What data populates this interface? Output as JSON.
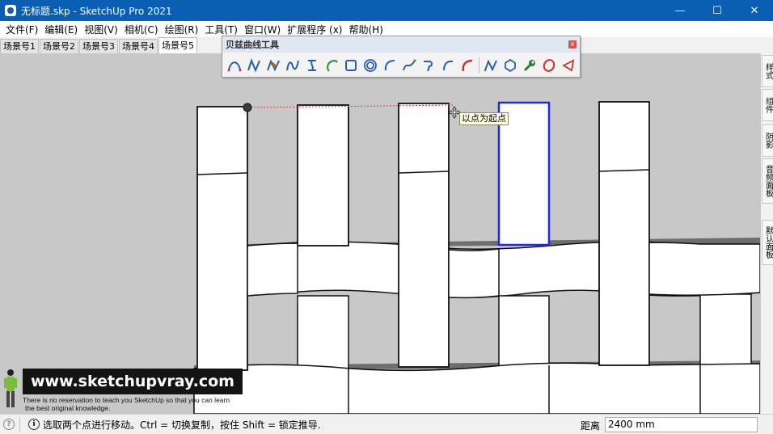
{
  "window": {
    "title": "无标题.skp - SketchUp Pro 2021",
    "minimize_glyph": "—",
    "maximize_glyph": "☐",
    "close_glyph": "✕",
    "titlebar_color": "#0b5fb3"
  },
  "menu": {
    "items": [
      {
        "label": "文件(F)"
      },
      {
        "label": "编辑(E)"
      },
      {
        "label": "视图(V)"
      },
      {
        "label": "相机(C)"
      },
      {
        "label": "绘图(R)"
      },
      {
        "label": "工具(T)"
      },
      {
        "label": "窗口(W)"
      },
      {
        "label": "扩展程序 (x)"
      },
      {
        "label": "帮助(H)"
      }
    ]
  },
  "scene_tabs": [
    {
      "label": "场景号1",
      "active": false
    },
    {
      "label": "场景号2",
      "active": false
    },
    {
      "label": "场景号3",
      "active": false
    },
    {
      "label": "场景号4",
      "active": false
    },
    {
      "label": "场景号5",
      "active": true
    }
  ],
  "bezier_toolbar": {
    "title": "贝兹曲线工具",
    "close_glyph": "x",
    "icons": [
      "bezier-arch-icon",
      "polyline-curve-icon",
      "spline-edit-icon",
      "freehand-curve-icon",
      "bspline-icon",
      "arc-curve-icon",
      "square-icon",
      "spiral-icon",
      "arc-open-icon",
      "cubic-bezier-icon",
      "hook-curve-icon",
      "quarter-arc-icon",
      "red-arc-icon",
      "smooth-curve-icon",
      "polygon-icon",
      "wrench-icon",
      "ellipse-icon",
      "triangle-icon"
    ]
  },
  "tooltip": {
    "text": "以点为起点"
  },
  "tray_tabs": [
    {
      "label": "样式"
    },
    {
      "label": "组件"
    },
    {
      "label": "阴影"
    },
    {
      "label": "音频面板"
    },
    {
      "label": "默认面板"
    }
  ],
  "watermark": {
    "banner": "www.sketchupvray.com",
    "line1": "There is no reservation to teach you SketchUp so that you can learn",
    "line2": "the best original knowledge."
  },
  "statusbar": {
    "geo_icon": "?",
    "info_icon": "i",
    "message": "选取两个点进行移动。Ctrl = 切换复制，按住 Shift = 锁定推导.",
    "distance_label": "距离",
    "distance_value": "2400 mm"
  },
  "colors": {
    "viewport_bg": "#c8c8c8",
    "selection_blue": "#1e2adf",
    "guide_red": "#e0393a"
  }
}
